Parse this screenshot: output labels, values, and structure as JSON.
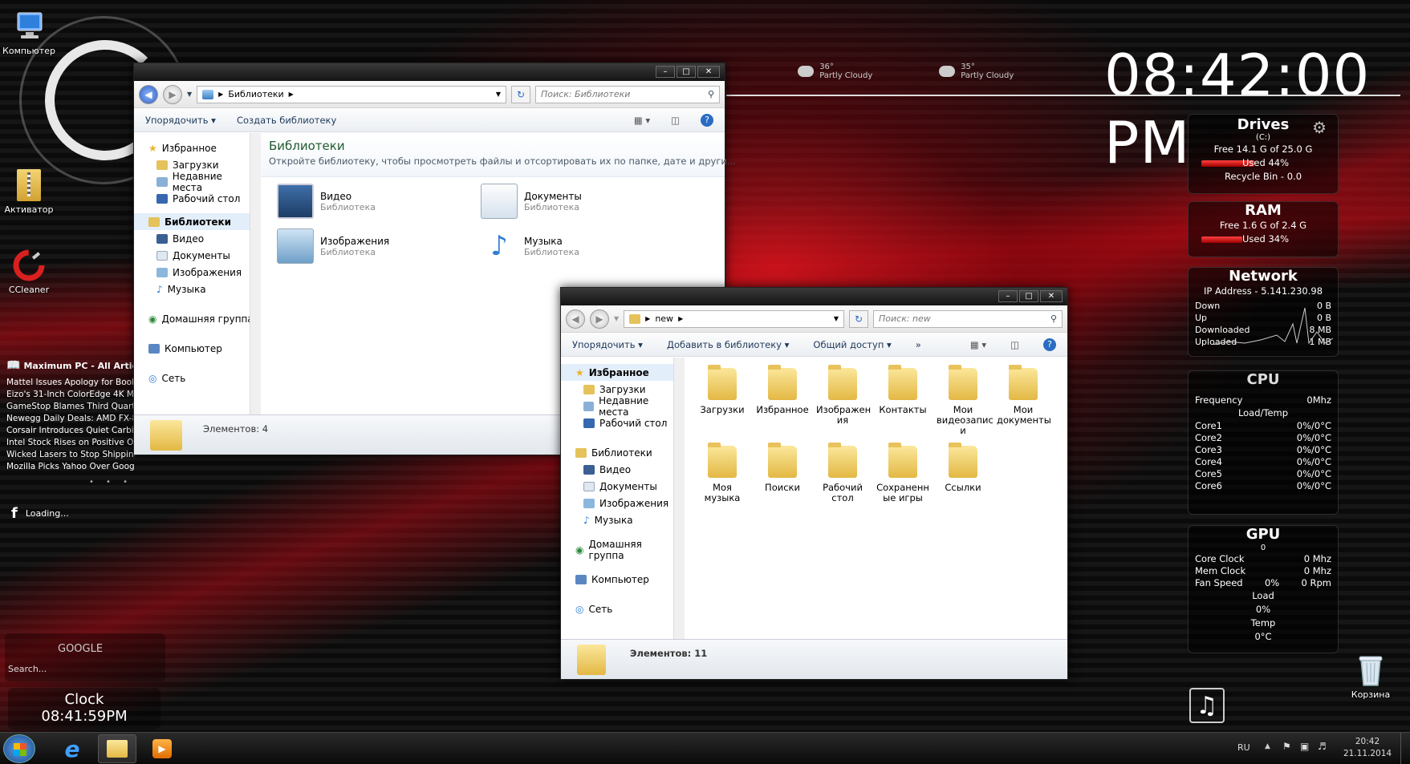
{
  "desktop": {
    "icons": [
      {
        "label": "Компьютер"
      },
      {
        "label": "Активатор"
      },
      {
        "label": "CCleaner"
      },
      {
        "label": "Корзина"
      }
    ],
    "news": {
      "title": "Maximum PC - All Articles",
      "items": [
        "Mattel Issues Apology for Book",
        "Eizo's 31-Inch ColorEdge 4K Mo",
        "GameStop Blames Third Quarter",
        "Newegg Daily Deals: AMD FX-83",
        "Corsair Introduces Quiet Carbid",
        "Intel Stock Rises on Positive Ou",
        "Wicked Lasers to Stop Shipping",
        "Mozilla Picks Yahoo Over Google a..."
      ]
    },
    "facebook_loading": "Loading...",
    "google": {
      "title": "GOOGLE",
      "search_placeholder": "Search..."
    },
    "clock_widget": {
      "title": "Clock",
      "time": "08:41:59PM"
    },
    "big_clock": "08:42:00 PM",
    "weather": [
      {
        "temp": "36°",
        "desc": "Partly Cloudy"
      },
      {
        "temp": "35°",
        "desc": "Partly Cloudy"
      }
    ]
  },
  "drives": {
    "title": "Drives",
    "drive": "(C:)",
    "free": "Free 14.1 G of 25.0 G",
    "used": "Used 44%",
    "used_pct": 44,
    "recycle": "Recycle Bin - 0.0"
  },
  "ram": {
    "title": "RAM",
    "free": "Free 1.6 G of 2.4 G",
    "used": "Used 34%",
    "used_pct": 34
  },
  "network": {
    "title": "Network",
    "ip": "IP Address - 5.141.230.98",
    "rows": [
      {
        "label": "Down",
        "value": "0 B"
      },
      {
        "label": "Up",
        "value": "0 B"
      },
      {
        "label": "Downloaded",
        "value": "8 MB"
      },
      {
        "label": "Uploaded",
        "value": "1 MB"
      }
    ]
  },
  "cpu": {
    "title": "CPU",
    "frequency_label": "Frequency",
    "frequency_value": "0Mhz",
    "loadtemp_label": "Load/Temp",
    "cores": [
      {
        "name": "Core1",
        "value": "0%/0°C"
      },
      {
        "name": "Core2",
        "value": "0%/0°C"
      },
      {
        "name": "Core3",
        "value": "0%/0°C"
      },
      {
        "name": "Core4",
        "value": "0%/0°C"
      },
      {
        "name": "Core5",
        "value": "0%/0°C"
      },
      {
        "name": "Core6",
        "value": "0%/0°C"
      }
    ]
  },
  "gpu": {
    "title": "GPU",
    "index": "0",
    "core_clock_label": "Core Clock",
    "core_clock": "0 Mhz",
    "mem_clock_label": "Mem Clock",
    "mem_clock": "0 Mhz",
    "fan_label": "Fan Speed",
    "fan_pct": "0%",
    "fan_rpm": "0 Rpm",
    "load_label": "Load",
    "load": "0%",
    "temp_label": "Temp",
    "temp": "0°C"
  },
  "window1": {
    "address": "Библиотеки",
    "search_placeholder": "Поиск: Библиотеки",
    "cmd_organize": "Упорядочить",
    "cmd_create_library": "Создать библиотеку",
    "nav": {
      "favorites": "Избранное",
      "downloads": "Загрузки",
      "recent": "Недавние места",
      "desktop": "Рабочий стол",
      "libraries": "Библиотеки",
      "video": "Видео",
      "documents": "Документы",
      "images": "Изображения",
      "music": "Музыка",
      "homegroup": "Домашняя группа",
      "computer": "Компьютер",
      "network": "Сеть"
    },
    "heading": "Библиотеки",
    "subheading": "Откройте библиотеку, чтобы просмотреть файлы и отсортировать их по папке, дате и други...",
    "libraries": [
      {
        "name": "Видео",
        "type": "Библиотека"
      },
      {
        "name": "Документы",
        "type": "Библиотека"
      },
      {
        "name": "Изображения",
        "type": "Библиотека"
      },
      {
        "name": "Музыка",
        "type": "Библиотека"
      }
    ],
    "status": "Элементов: 4"
  },
  "window2": {
    "address": "new",
    "search_placeholder": "Поиск: new",
    "cmd_organize": "Упорядочить",
    "cmd_add_library": "Добавить в библиотеку",
    "cmd_share": "Общий доступ",
    "cmd_more": "»",
    "nav": {
      "favorites": "Избранное",
      "downloads": "Загрузки",
      "recent": "Недавние места",
      "desktop": "Рабочий стол",
      "libraries": "Библиотеки",
      "video": "Видео",
      "documents": "Документы",
      "images": "Изображения",
      "music": "Музыка",
      "homegroup": "Домашняя группа",
      "computer": "Компьютер",
      "network": "Сеть"
    },
    "items": [
      {
        "l1": "Загрузки",
        "l2": "",
        "l3": ""
      },
      {
        "l1": "Избранное",
        "l2": "",
        "l3": ""
      },
      {
        "l1": "Изображен",
        "l2": "ия",
        "l3": ""
      },
      {
        "l1": "Контакты",
        "l2": "",
        "l3": ""
      },
      {
        "l1": "Мои",
        "l2": "видеозапис",
        "l3": "и"
      },
      {
        "l1": "Мои",
        "l2": "документы",
        "l3": ""
      },
      {
        "l1": "Моя",
        "l2": "музыка",
        "l3": ""
      },
      {
        "l1": "Поиски",
        "l2": "",
        "l3": ""
      },
      {
        "l1": "Рабочий",
        "l2": "стол",
        "l3": ""
      },
      {
        "l1": "Сохраненн",
        "l2": "ые игры",
        "l3": ""
      },
      {
        "l1": "Ссылки",
        "l2": "",
        "l3": ""
      }
    ],
    "status": "Элементов: 11"
  },
  "taskbar": {
    "lang": "RU",
    "time": "20:42",
    "date": "21.11.2014"
  }
}
